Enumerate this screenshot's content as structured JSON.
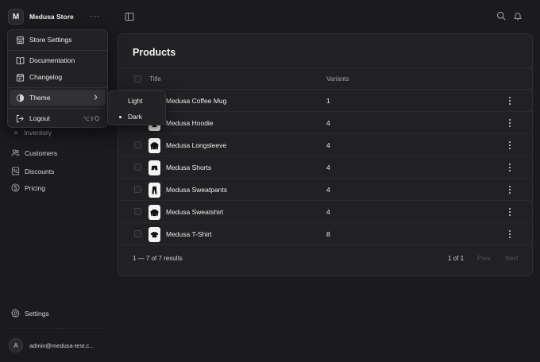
{
  "store": {
    "initial": "M",
    "name": "Medusa Store",
    "more": "···"
  },
  "nav": {
    "inventory": "Inventory",
    "customers": "Customers",
    "discounts": "Discounts",
    "pricing": "Pricing",
    "settings": "Settings"
  },
  "user": {
    "initial": "A",
    "email": "admin@medusa-test.c..."
  },
  "menu": {
    "store_settings": "Store Settings",
    "documentation": "Documentation",
    "changelog": "Changelog",
    "theme": "Theme",
    "logout": "Logout",
    "logout_shortcut": "⌥⇧Q"
  },
  "theme_submenu": {
    "light": "Light",
    "dark": "Dark",
    "selected": "Dark"
  },
  "products": {
    "title": "Products",
    "columns": {
      "title": "Title",
      "variants": "Variants"
    },
    "rows": [
      {
        "title": "Medusa Coffee Mug",
        "variants": "1",
        "icon": "mug-icon"
      },
      {
        "title": "Medusa Hoodie",
        "variants": "4",
        "icon": "hoodie-icon"
      },
      {
        "title": "Medusa Longsleeve",
        "variants": "4",
        "icon": "longsleeve-icon"
      },
      {
        "title": "Medusa Shorts",
        "variants": "4",
        "icon": "shorts-icon"
      },
      {
        "title": "Medusa Sweatpants",
        "variants": "4",
        "icon": "sweatpants-icon"
      },
      {
        "title": "Medusa Sweatshirt",
        "variants": "4",
        "icon": "sweatshirt-icon"
      },
      {
        "title": "Medusa T-Shirt",
        "variants": "8",
        "icon": "tshirt-icon"
      }
    ],
    "pagination": {
      "count": "1 — 7 of 7 results",
      "pages": "1 of 1",
      "prev": "Prev",
      "next": "Next"
    }
  }
}
